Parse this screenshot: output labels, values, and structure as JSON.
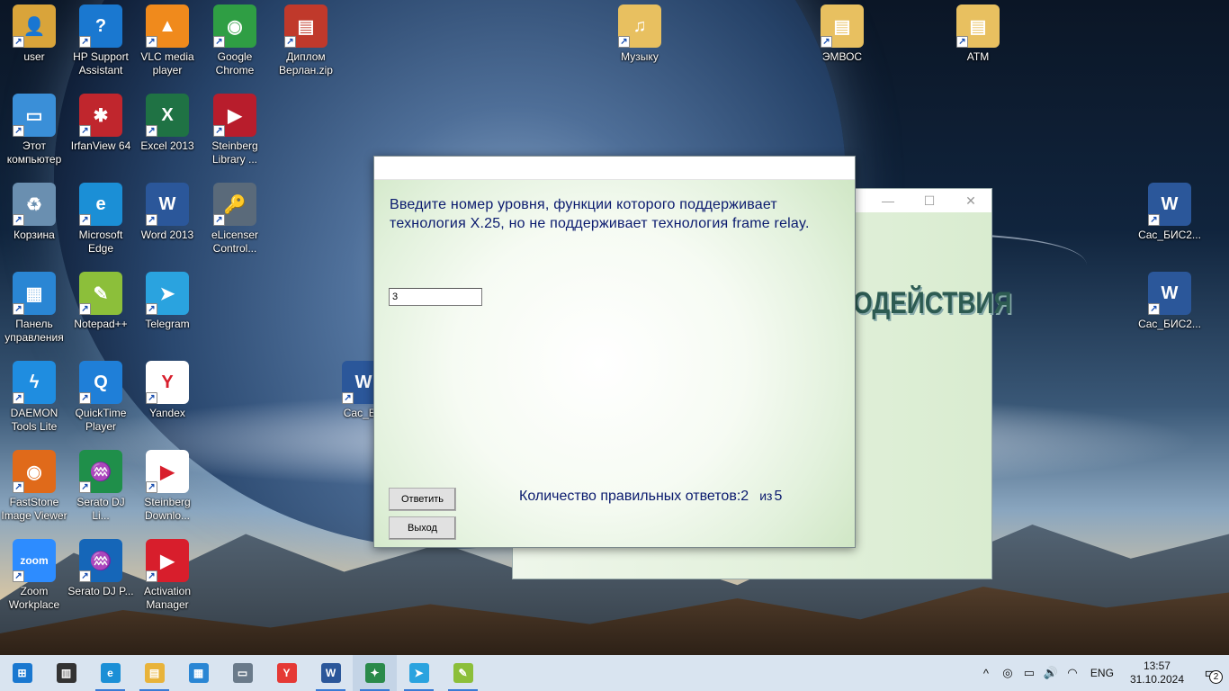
{
  "desktop": {
    "icons": [
      {
        "label": "user",
        "icon": "user-folder-icon",
        "color": "#d9a43a",
        "glyph": "👤"
      },
      {
        "label": "HP Support\nAssistant",
        "icon": "hp-support-icon",
        "color": "#1a78d0",
        "glyph": "?"
      },
      {
        "label": "VLC media\nplayer",
        "icon": "vlc-icon",
        "color": "#f08a1c",
        "glyph": "▲"
      },
      {
        "label": "Google\nChrome",
        "icon": "chrome-icon",
        "color": "#2f9e44",
        "glyph": "◉"
      },
      {
        "label": "Диплом\nВерлан.zip",
        "icon": "zip-archive-icon",
        "color": "#c0392b",
        "glyph": "▤"
      },
      {
        "label": "Музыку",
        "icon": "music-folder-icon",
        "color": "#e8c060",
        "glyph": "♫"
      },
      {
        "label": "ЭМВОС",
        "icon": "folder-icon",
        "color": "#e8c060",
        "glyph": "▤"
      },
      {
        "label": "ATM",
        "icon": "folder-icon",
        "color": "#e8c060",
        "glyph": "▤"
      },
      {
        "label": "Этот\nкомпьютер",
        "icon": "this-pc-icon",
        "color": "#3a8fd8",
        "glyph": "▭"
      },
      {
        "label": "IrfanView 64",
        "icon": "irfanview-icon",
        "color": "#c0262d",
        "glyph": "✱"
      },
      {
        "label": "Excel 2013",
        "icon": "excel-icon",
        "color": "#1f7244",
        "glyph": "X"
      },
      {
        "label": "Steinberg\nLibrary ...",
        "icon": "steinberg-library-icon",
        "color": "#b81d2c",
        "glyph": "▶"
      },
      {
        "label": "Корзина",
        "icon": "recycle-bin-icon",
        "color": "#6a8fb0",
        "glyph": "♻"
      },
      {
        "label": "Microsoft\nEdge",
        "icon": "edge-icon",
        "color": "#1b8fd6",
        "glyph": "e"
      },
      {
        "label": "Word 2013",
        "icon": "word-icon",
        "color": "#2b579a",
        "glyph": "W"
      },
      {
        "label": "eLicenser\nControl...",
        "icon": "elicenser-icon",
        "color": "#5a6a7a",
        "glyph": "🔑"
      },
      {
        "label": "Cac_БИС2...",
        "icon": "word-document-icon",
        "color": "#2b579a",
        "glyph": "W"
      },
      {
        "label": "Панель\nуправления",
        "icon": "control-panel-icon",
        "color": "#2a86d4",
        "glyph": "▦"
      },
      {
        "label": "Notepad++",
        "icon": "notepad-plus-plus-icon",
        "color": "#8cbf3a",
        "glyph": "✎"
      },
      {
        "label": "Telegram",
        "icon": "telegram-icon",
        "color": "#2aa3df",
        "glyph": "➤"
      },
      {
        "label": "Cac_БИС2...",
        "icon": "word-document-icon",
        "color": "#2b579a",
        "glyph": "W"
      },
      {
        "label": "DAEMON\nTools Lite",
        "icon": "daemon-tools-icon",
        "color": "#1f8de0",
        "glyph": "ϟ"
      },
      {
        "label": "QuickTime\nPlayer",
        "icon": "quicktime-icon",
        "color": "#1f7fd8",
        "glyph": "Q"
      },
      {
        "label": "Yandex",
        "icon": "yandex-icon",
        "color": "#ffffff",
        "glyph": "Y"
      },
      {
        "label": "Cac_БИ",
        "icon": "word-document-icon",
        "color": "#2b579a",
        "glyph": "W"
      },
      {
        "label": "FastStone\nImage Viewer",
        "icon": "faststone-icon",
        "color": "#e06a1a",
        "glyph": "◉"
      },
      {
        "label": "Serato DJ Li...",
        "icon": "serato-dj-lite-icon",
        "color": "#1f8f4a",
        "glyph": "♒"
      },
      {
        "label": "Steinberg\nDownlo...",
        "icon": "steinberg-download-icon",
        "color": "#ffffff",
        "glyph": "▶"
      },
      {
        "label": "Zoom\nWorkplace",
        "icon": "zoom-icon",
        "color": "#2d8cff",
        "glyph": "zoom"
      },
      {
        "label": "Serato DJ P...",
        "icon": "serato-dj-pro-icon",
        "color": "#1566b8",
        "glyph": "♒"
      },
      {
        "label": "Activation\nManager",
        "icon": "activation-manager-icon",
        "color": "#d81e2c",
        "glyph": "▶"
      }
    ]
  },
  "background_window": {
    "heading_fragment": "ОДЕЙСТВИЯ",
    "minimize": "—",
    "maximize": "☐",
    "close": "✕"
  },
  "dialog": {
    "question": "Введите номер уровня, функции которого поддерживает технология X.25, но не поддерживает технология frame relay.",
    "answer_value": "3",
    "answer_button": "Ответить",
    "exit_button": "Выход",
    "score_label": "Количество правильных ответов:",
    "score_correct": "2",
    "score_of": "из",
    "score_total": "5"
  },
  "taskbar": {
    "items": [
      {
        "icon": "windows-start-icon",
        "glyph": "⊞",
        "color": "#1a78d0"
      },
      {
        "icon": "task-view-icon",
        "glyph": "▥",
        "color": "#333333"
      },
      {
        "icon": "edge-icon",
        "glyph": "e",
        "color": "#1b8fd6"
      },
      {
        "icon": "file-explorer-icon",
        "glyph": "▤",
        "color": "#e8b33a"
      },
      {
        "icon": "microsoft-store-icon",
        "glyph": "▦",
        "color": "#2a86d4"
      },
      {
        "icon": "remote-desktop-icon",
        "glyph": "▭",
        "color": "#6a7a8a"
      },
      {
        "icon": "yandex-icon",
        "glyph": "Y",
        "color": "#e53935"
      },
      {
        "icon": "word-icon",
        "glyph": "W",
        "color": "#2b579a"
      },
      {
        "icon": "test-app-icon",
        "glyph": "✦",
        "color": "#2a8a4a"
      },
      {
        "icon": "telegram-icon",
        "glyph": "➤",
        "color": "#2aa3df"
      },
      {
        "icon": "notepad-plus-plus-icon",
        "glyph": "✎",
        "color": "#8cbf3a"
      }
    ],
    "tray": {
      "chevron": "^",
      "language": "ENG",
      "time": "13:57",
      "date": "31.10.2024",
      "notifications_count": "2"
    }
  }
}
